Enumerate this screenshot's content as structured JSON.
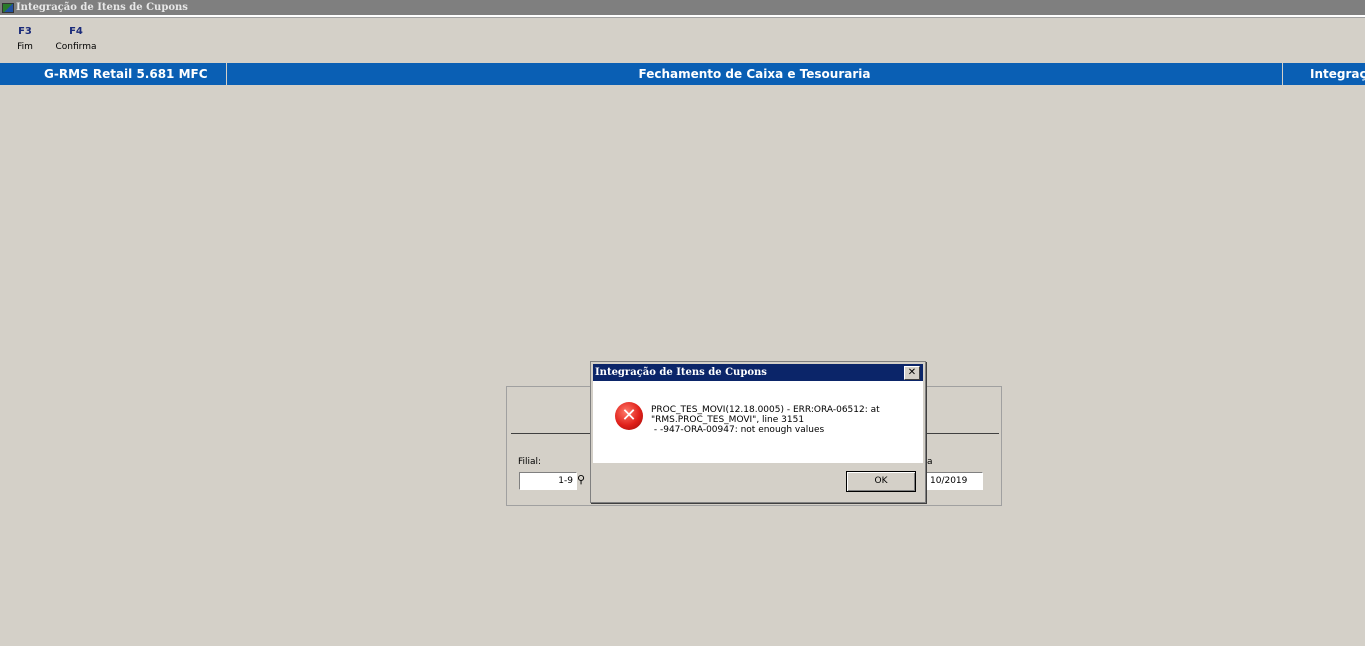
{
  "window": {
    "title": "Integração de Itens de Cupons"
  },
  "toolbar": {
    "keys": [
      {
        "key": "F3",
        "label": "Fim"
      },
      {
        "key": "F4",
        "label": "Confirma"
      }
    ]
  },
  "header_band": {
    "product": "G-RMS Retail 5.681 MFC",
    "module": "Fechamento de Caixa e Tesouraria",
    "screen": "Integraç"
  },
  "form": {
    "filial_label": "Filial:",
    "filial_value": "1-9",
    "data_label": "a",
    "data_value": "10/2019"
  },
  "dialog": {
    "title": "Integração de Itens de Cupons",
    "close": "✕",
    "icon": "error-icon",
    "message": "PROC_TES_MOVI(12.18.0005) - ERR:ORA-06512: at\n\"RMS.PROC_TES_MOVI\", line 3151\n - -947-ORA-00947: not enough values",
    "ok_label": "OK"
  },
  "colors": {
    "band": "#0a5fb4",
    "dialog_title": "#0b2569",
    "background": "#d4d0c8"
  }
}
